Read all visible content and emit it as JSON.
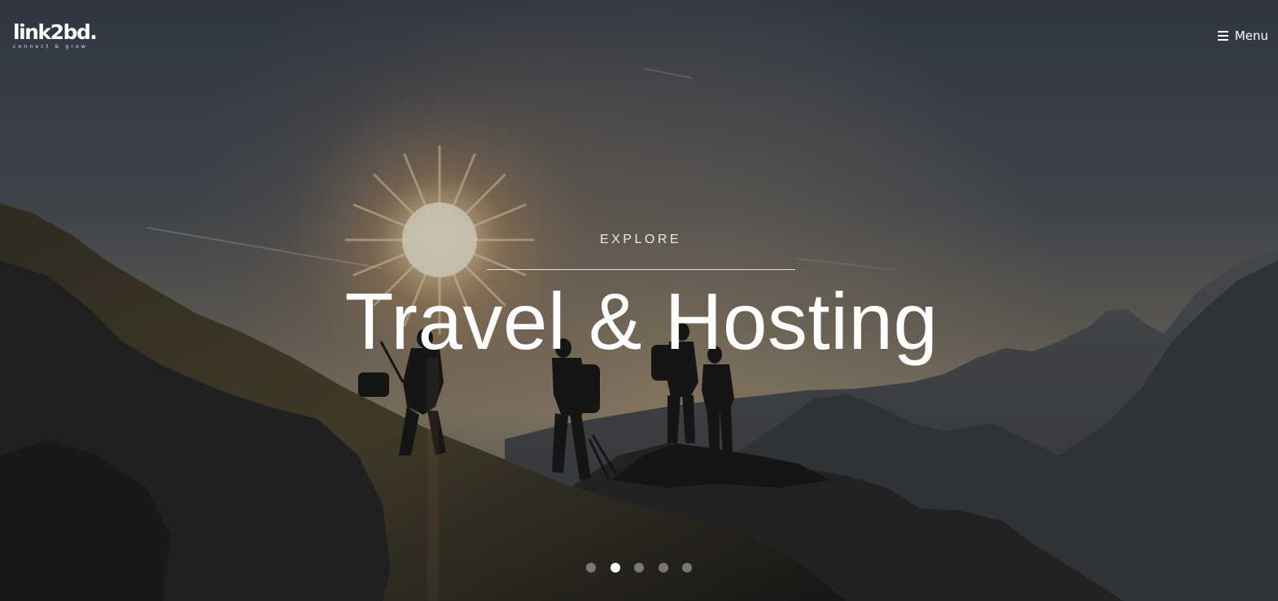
{
  "header": {
    "logo_text": "link2bd.",
    "logo_tagline": "connect & grow",
    "menu_label": "Menu"
  },
  "hero": {
    "kicker": "EXPLORE",
    "headline": "Travel & Hosting",
    "image_description_icon": "mountain-hikers-sunset-image"
  },
  "slider": {
    "slide_count": 5,
    "active_slide": 2
  },
  "colors": {
    "text": "#ffffff",
    "dot_inactive": "#bebebe",
    "dot_active": "#ffffff"
  }
}
